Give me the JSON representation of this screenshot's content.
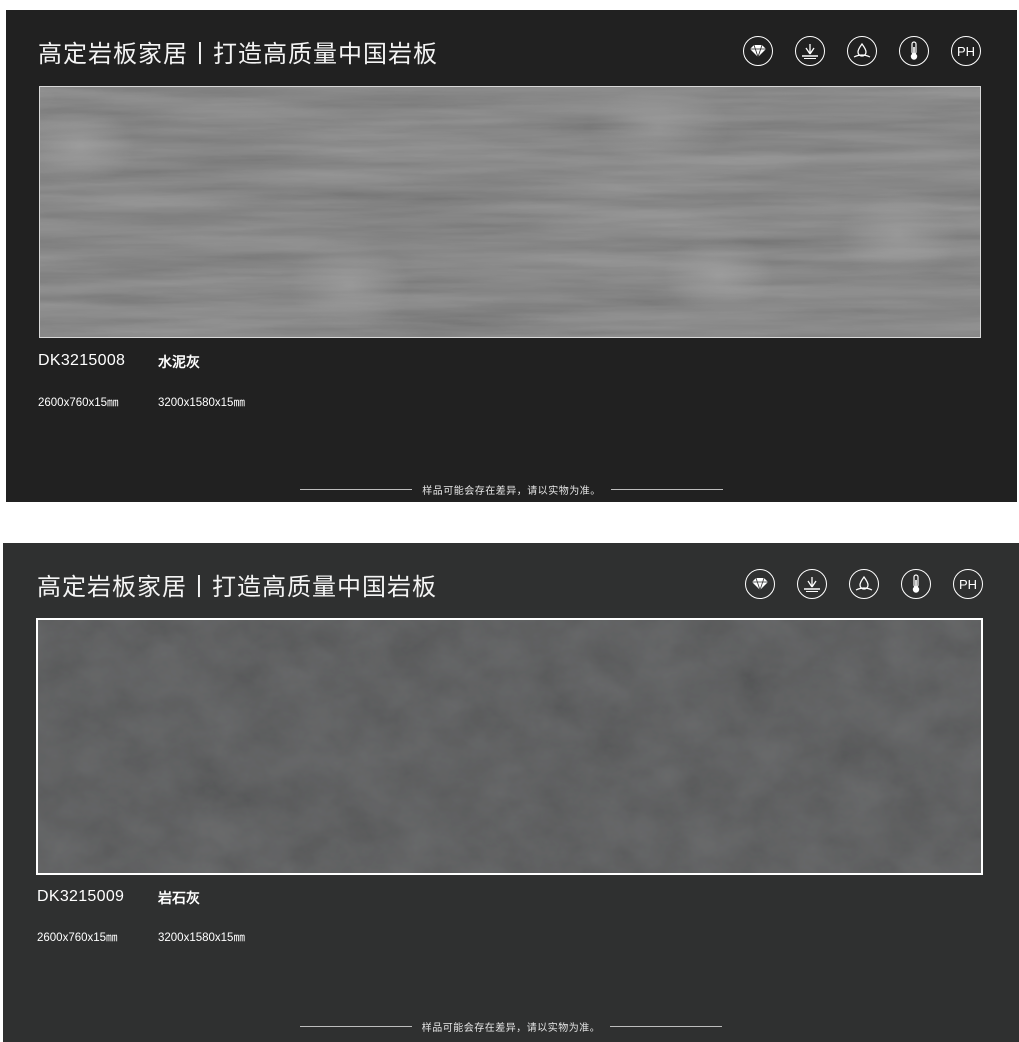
{
  "cards": [
    {
      "title": "高定岩板家居丨打造高质量中国岩板",
      "background": "#212121",
      "slab_color": "#858585",
      "code": "DK3215008",
      "name": "水泥灰",
      "sizes": [
        "2600x760x15㎜",
        "3200x1580x15㎜"
      ],
      "disclaimer": "样品可能会存在差异，请以实物为准。",
      "icons": [
        "diamond-icon",
        "anti-slip-icon",
        "water-drop-icon",
        "thermometer-icon",
        "ph-icon"
      ],
      "ph_label": "PH"
    },
    {
      "title": "高定岩板家居丨打造高质量中国岩板",
      "background": "#2f3030",
      "slab_color": "#555657",
      "code": "DK3215009",
      "name": "岩石灰",
      "sizes": [
        "2600x760x15㎜",
        "3200x1580x15㎜"
      ],
      "disclaimer": "样品可能会存在差异，请以实物为准。",
      "icons": [
        "diamond-icon",
        "anti-slip-icon",
        "water-drop-icon",
        "thermometer-icon",
        "ph-icon"
      ],
      "ph_label": "PH"
    }
  ]
}
